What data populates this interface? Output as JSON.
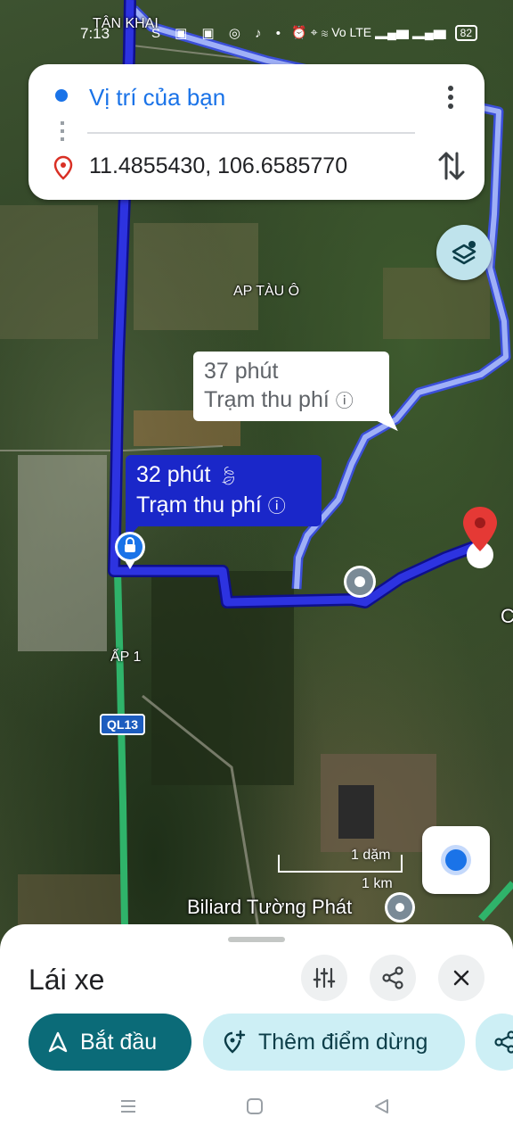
{
  "status_bar": {
    "time": "7:13",
    "notification_icons": "S ▣ ▣ ◎ ♪ •",
    "system_icons": "⏰ ⌖ ≋ Vo LTE ▂▄▆ ▂▄▆",
    "battery": "82"
  },
  "directions": {
    "from": "Vị trí của bạn",
    "to": "11.4855430, 106.6585770"
  },
  "map": {
    "labels": {
      "tan_khai": "TÂN KHAI",
      "ap_tau_o": "AP TÀU Ô",
      "ap_1": "ẤP 1",
      "road_ql13": "QL13",
      "edge_c": "C"
    },
    "alt_route": {
      "time": "37 phút",
      "note": "Trạm thu phí"
    },
    "main_route": {
      "time": "32 phút",
      "note": "Trạm thu phí"
    },
    "scale": {
      "miles": "1 dặm",
      "km": "1 km"
    },
    "poi": "Biliard Tường Phát"
  },
  "sheet": {
    "title": "Lái xe",
    "start_label": "Bắt đầu",
    "add_stop_label": "Thêm điểm dừng"
  },
  "colors": {
    "route_primary": "#2a2ad9",
    "route_alt": "#8fa3f5",
    "accent": "#0b6b78",
    "chip_light": "#cdeff5",
    "pin": "#e53935"
  },
  "icons": [
    "more-icon",
    "swap-icon",
    "layers-icon",
    "equalizer-icon",
    "share-icon",
    "close-icon",
    "navigate-arrow-icon",
    "add-stop-icon",
    "locate-icon",
    "toll-icon",
    "eco-leaf-icon"
  ]
}
